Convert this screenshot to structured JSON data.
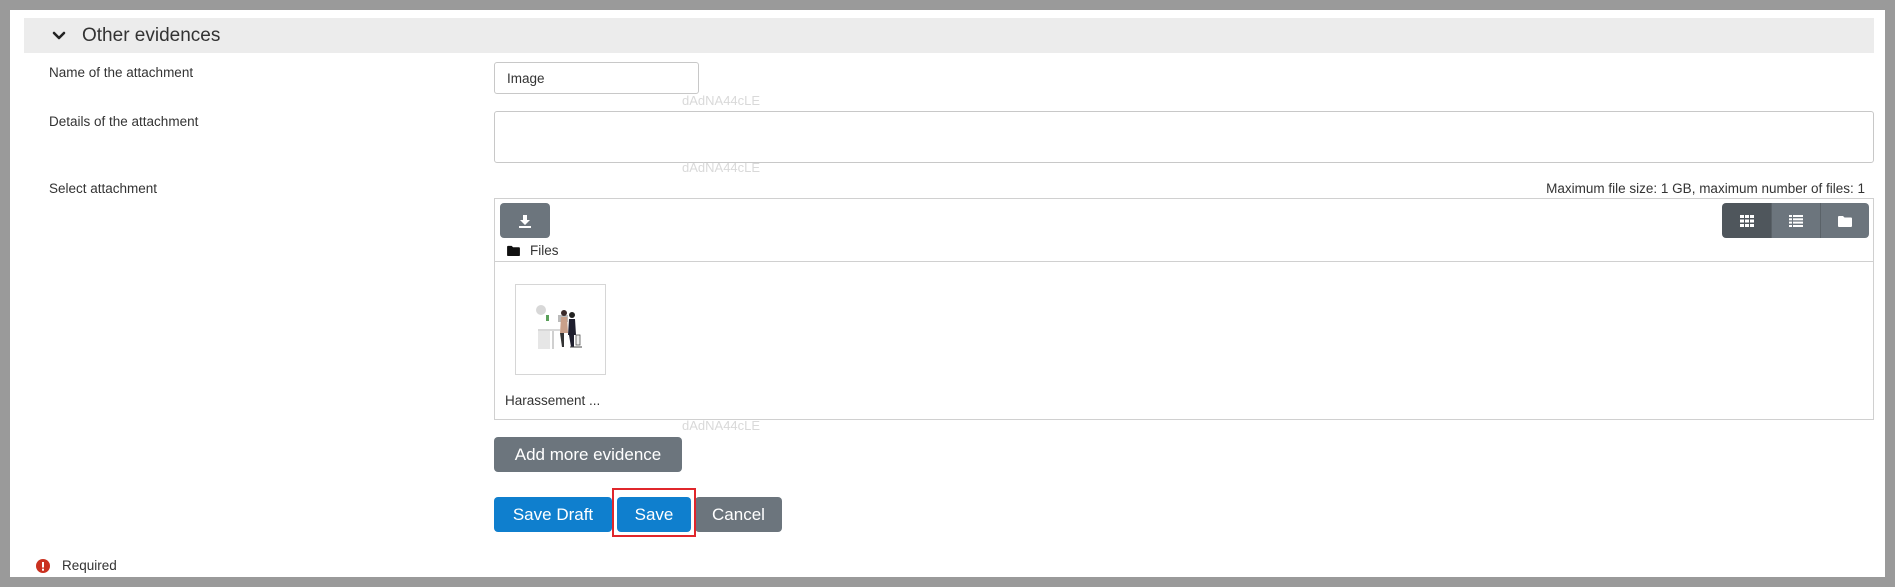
{
  "section": {
    "title": "Other evidences"
  },
  "form": {
    "name_label": "Name of the attachment",
    "name_value": "Image",
    "details_label": "Details of the attachment",
    "details_value": "",
    "select_label": "Select attachment",
    "watermark": "dAdNA44cLE",
    "max_size_text": "Maximum file size: 1 GB, maximum number of files: 1"
  },
  "filemanager": {
    "path_label": "Files",
    "file_caption": "Harassement ...",
    "icons": {
      "download": "download-icon",
      "grid": "grid-view-icon",
      "list": "list-view-icon",
      "tree": "folder-view-icon"
    }
  },
  "buttons": {
    "add_more": "Add more evidence",
    "save_draft": "Save Draft",
    "save": "Save",
    "cancel": "Cancel"
  },
  "footer": {
    "required_label": "Required"
  },
  "colors": {
    "primary": "#0f7fce",
    "secondary": "#6c757d",
    "highlight": "#e0262b",
    "required_icon": "#ca3120"
  }
}
